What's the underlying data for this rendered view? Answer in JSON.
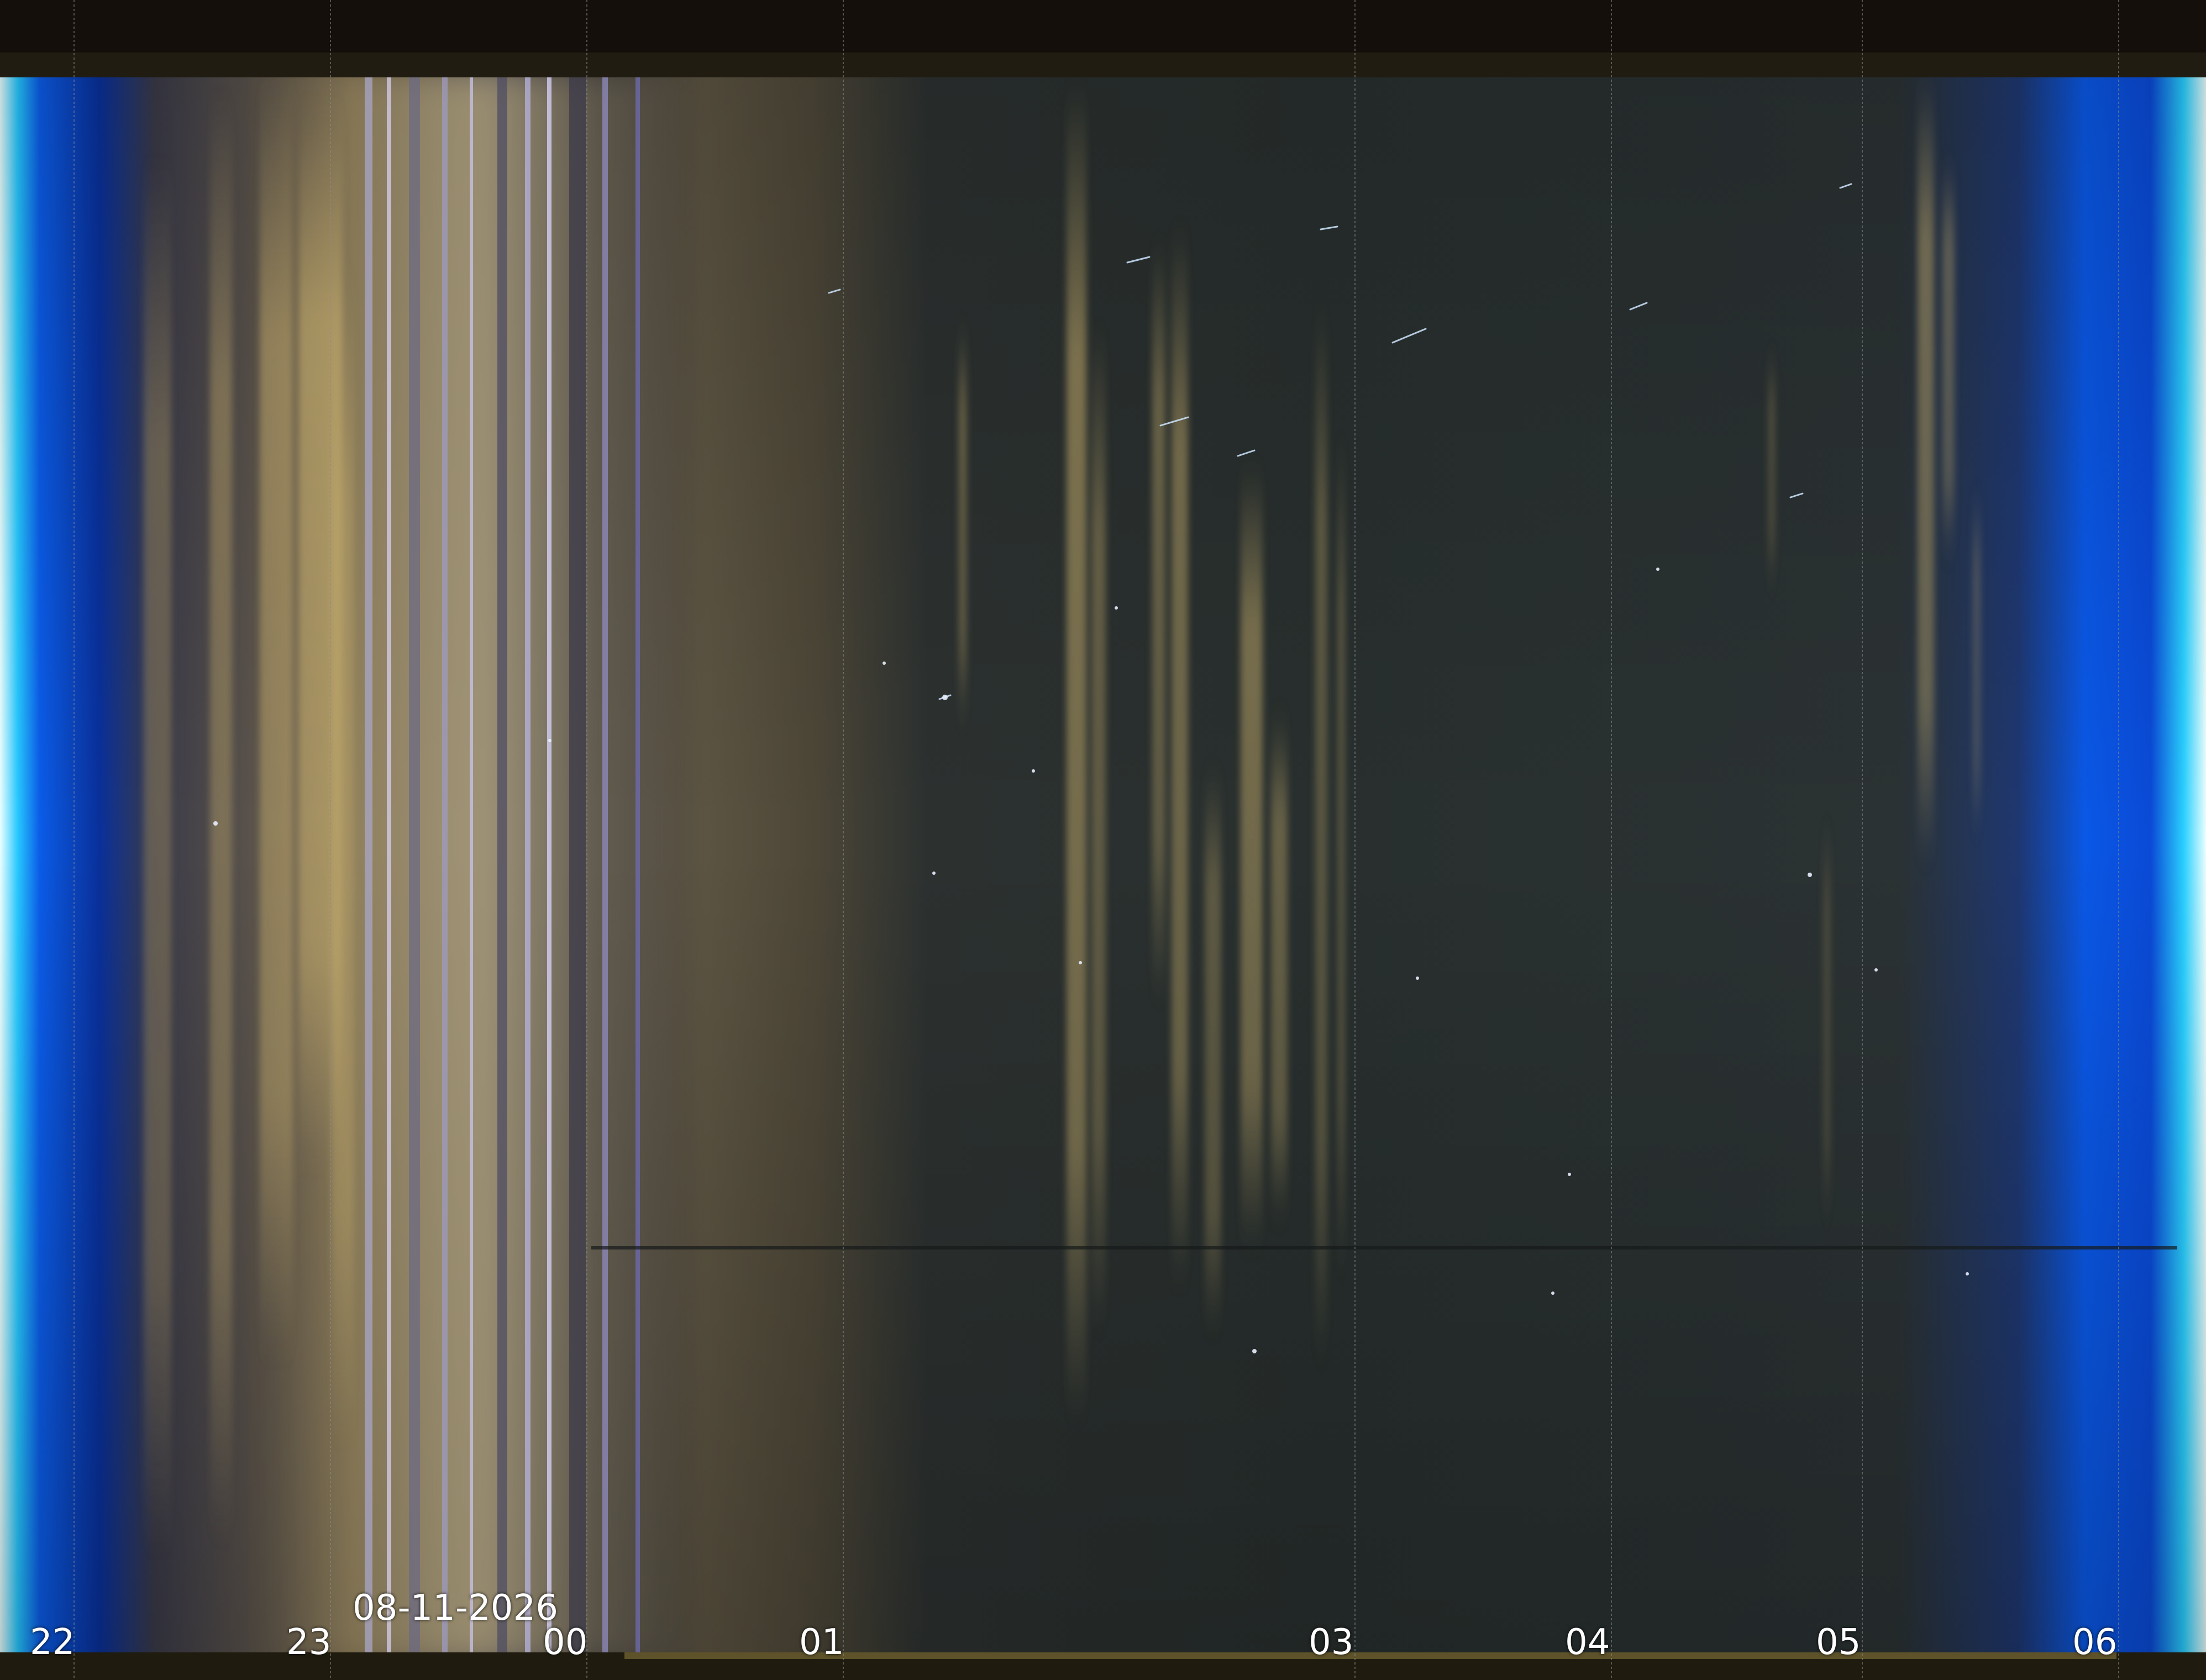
{
  "hours": {
    "h22": "22",
    "h23": "23",
    "h00": "00",
    "h01": "01",
    "h03": "03",
    "h04": "04",
    "h05": "05",
    "h06": "06"
  },
  "date": "08-11-2026",
  "colors": {
    "twilight_blue": "#0a5fe6",
    "twilight_cyan": "#38c8ff",
    "night_sky": "#27302f",
    "moonlight_glow": "#6b5a3e",
    "cloud_streak": "#c9b06e",
    "frame_bar": "#1c1a10",
    "hour_gridline": "#8c8c8c",
    "label_text": "#ffffff"
  }
}
